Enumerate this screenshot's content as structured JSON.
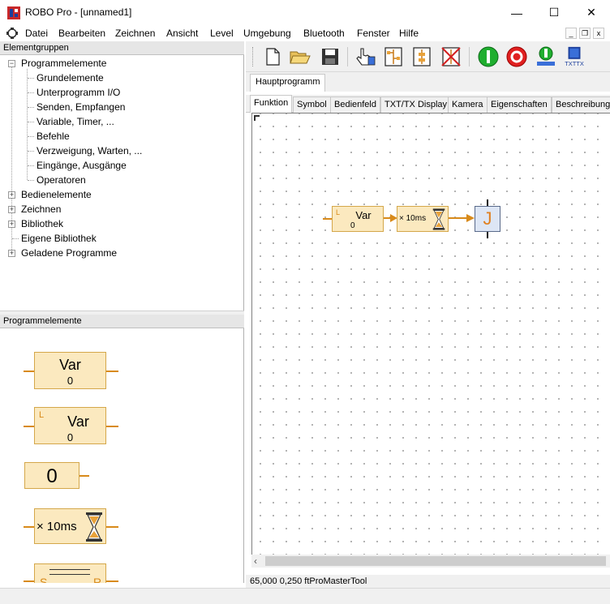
{
  "window": {
    "title": "ROBO Pro - [unnamed1]",
    "minimize": "—",
    "maximize": "☐",
    "close": "✕"
  },
  "menu": {
    "items": [
      "Datei",
      "Bearbeiten",
      "Zeichnen",
      "Ansicht",
      "Level",
      "Umgebung",
      "Bluetooth",
      "Fenster",
      "Hilfe"
    ],
    "mdi_minimize": "_",
    "mdi_restore": "❐",
    "mdi_close": "x"
  },
  "tree_panel": {
    "header": "Elementgruppen",
    "root_label": "Programmelemente",
    "children": [
      "Grundelemente",
      "Unterprogramm I/O",
      "Senden, Empfangen",
      "Variable, Timer, ...",
      "Befehle",
      "Verzweigung, Warten, ...",
      "Eingänge, Ausgänge",
      "Operatoren"
    ],
    "siblings": [
      {
        "label": "Bedienelemente",
        "expandable": true
      },
      {
        "label": "Zeichnen",
        "expandable": true
      },
      {
        "label": "Bibliothek",
        "expandable": true
      },
      {
        "label": "Eigene Bibliothek",
        "expandable": false
      },
      {
        "label": "Geladene Programme",
        "expandable": true
      }
    ]
  },
  "palette_panel": {
    "header": "Programmelemente",
    "var_block": {
      "title": "Var",
      "value": "0"
    },
    "local_var_block": {
      "prefix": "L",
      "title": "Var",
      "value": "0"
    },
    "const_block": {
      "value": "0"
    },
    "timer_block": {
      "label": "× 10ms"
    },
    "flipflop_block": {
      "s": "S",
      "r": "R"
    }
  },
  "tabs": {
    "program_tab": "Hauptprogramm",
    "view_tabs": [
      "Funktion",
      "Symbol",
      "Bedienfeld",
      "TXT/TX Display",
      "Kamera",
      "Eigenschaften",
      "Beschreibung"
    ],
    "active_view": "Funktion"
  },
  "toolbar": {
    "txt_label": "TXTTX"
  },
  "canvas": {
    "var_block": {
      "prefix": "L",
      "title": "Var",
      "value": "0"
    },
    "timer_block": {
      "label": "× 10ms"
    },
    "join_block": {
      "label": "J"
    }
  },
  "status": {
    "text": "65,000  0,250  ftProMasterTool"
  },
  "colors": {
    "block_fill": "#fbe9bf",
    "block_border": "#d4a74a",
    "wire": "#d88a1a",
    "join_fill": "#dde6f5",
    "join_letter": "#e08020"
  }
}
